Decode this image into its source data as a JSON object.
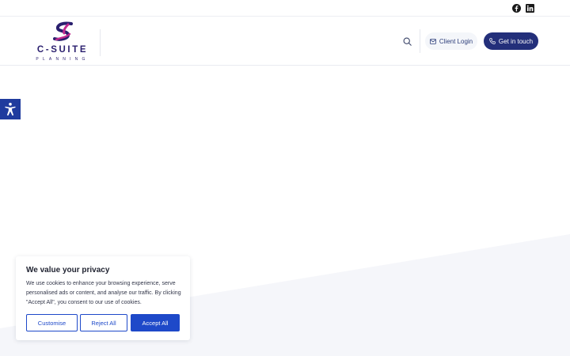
{
  "topbar": {
    "social": [
      "facebook-icon",
      "linkedin-icon"
    ]
  },
  "brand": {
    "name": "C-SUITE",
    "tagline": "PLANNING",
    "colors": {
      "navy": "#2a1f6e",
      "magenta": "#c02a8e"
    }
  },
  "nav": {
    "client_login": "Client Login",
    "get_in_touch": "Get in touch",
    "icons": {
      "search": "search-icon",
      "mail": "mail-icon",
      "phone": "phone-icon"
    }
  },
  "accessibility": {
    "icon": "accessibility-icon",
    "color": "#1f3b9e"
  },
  "cookie": {
    "title": "We value your privacy",
    "body": "We use cookies to enhance your browsing experience, serve personalised ads or content, and analyse our traffic. By clicking \"Accept All\", you consent to our use of cookies.",
    "customise": "Customise",
    "reject": "Reject All",
    "accept": "Accept All",
    "accent": "#1e49c9"
  }
}
